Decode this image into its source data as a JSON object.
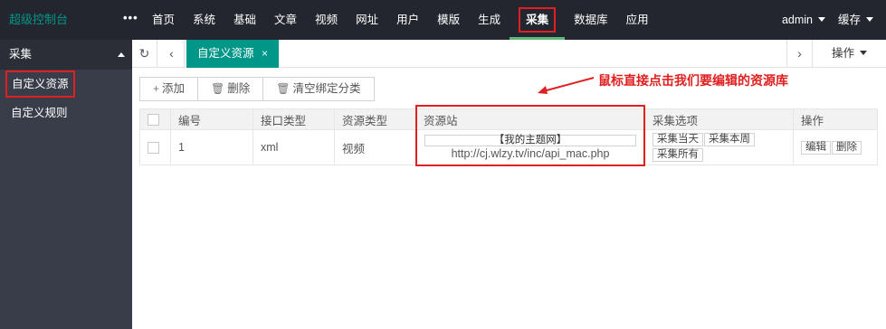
{
  "app": {
    "title": "超级控制台",
    "more_label": "•••"
  },
  "topnav": {
    "items": [
      {
        "label": "首页"
      },
      {
        "label": "系统"
      },
      {
        "label": "基础"
      },
      {
        "label": "文章"
      },
      {
        "label": "视频"
      },
      {
        "label": "网址"
      },
      {
        "label": "用户"
      },
      {
        "label": "模版"
      },
      {
        "label": "生成"
      },
      {
        "label": "采集",
        "active": true
      },
      {
        "label": "数据库"
      },
      {
        "label": "应用"
      }
    ],
    "user": "admin",
    "cache": "缓存"
  },
  "sidebar": {
    "section": "采集",
    "items": [
      {
        "label": "自定义资源",
        "active": true
      },
      {
        "label": "自定义规则"
      }
    ]
  },
  "tabs": {
    "active_label": "自定义资源",
    "close": "×",
    "ops_label": "操作"
  },
  "toolbar": {
    "add": "添加",
    "delete": "删除",
    "clear_bind": "清空绑定分类"
  },
  "annotation": "鼠标直接点击我们要编辑的资源库",
  "table": {
    "headers": [
      "编号",
      "接口类型",
      "资源类型",
      "资源站",
      "采集选项",
      "操作"
    ],
    "rows": [
      {
        "id": "1",
        "api_type": "xml",
        "res_type": "视频",
        "site_name": "【我的主题网】",
        "site_url": "http://cj.wlzy.tv/inc/api_mac.php",
        "collect": [
          "采集当天",
          "采集本周",
          "采集所有"
        ],
        "ops": [
          "编辑",
          "删除"
        ]
      }
    ]
  },
  "colors": {
    "accent": "#009688",
    "topbar": "#23262e",
    "sidebar": "#393d49",
    "highlight": "#e02020"
  }
}
